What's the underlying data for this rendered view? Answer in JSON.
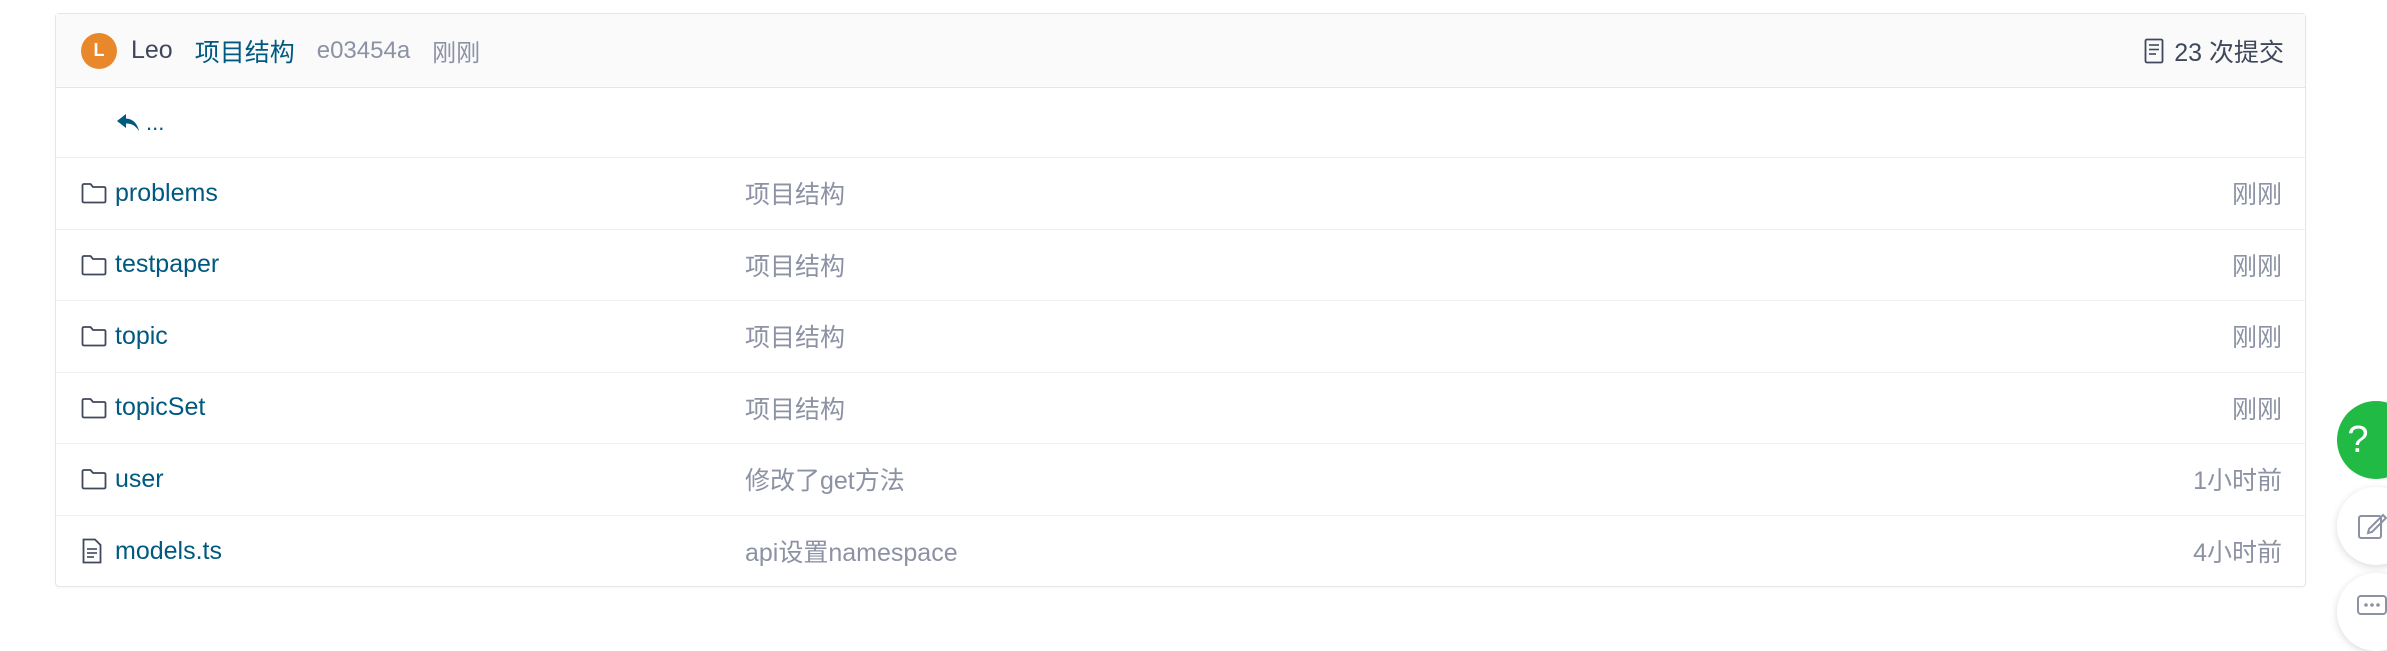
{
  "header": {
    "avatar_letter": "L",
    "author": "Leo",
    "commit_message": "项目结构",
    "commit_hash": "e03454a",
    "commit_time": "刚刚",
    "commits_count_label": "23 次提交"
  },
  "back_row": {
    "label": "..."
  },
  "files": [
    {
      "type": "folder",
      "name": "problems",
      "message": "项目结构",
      "time": "刚刚"
    },
    {
      "type": "folder",
      "name": "testpaper",
      "message": "项目结构",
      "time": "刚刚"
    },
    {
      "type": "folder",
      "name": "topic",
      "message": "项目结构",
      "time": "刚刚"
    },
    {
      "type": "folder",
      "name": "topicSet",
      "message": "项目结构",
      "time": "刚刚"
    },
    {
      "type": "folder",
      "name": "user",
      "message": "修改了get方法",
      "time": "1小时前"
    },
    {
      "type": "file",
      "name": "models.ts",
      "message": "api设置namespace",
      "time": "4小时前"
    }
  ],
  "floating": {
    "help_label": "?"
  },
  "colors": {
    "link": "#005980",
    "muted": "#8c92a4",
    "avatar_bg": "#e9882a",
    "help_bg": "#21ba45"
  }
}
